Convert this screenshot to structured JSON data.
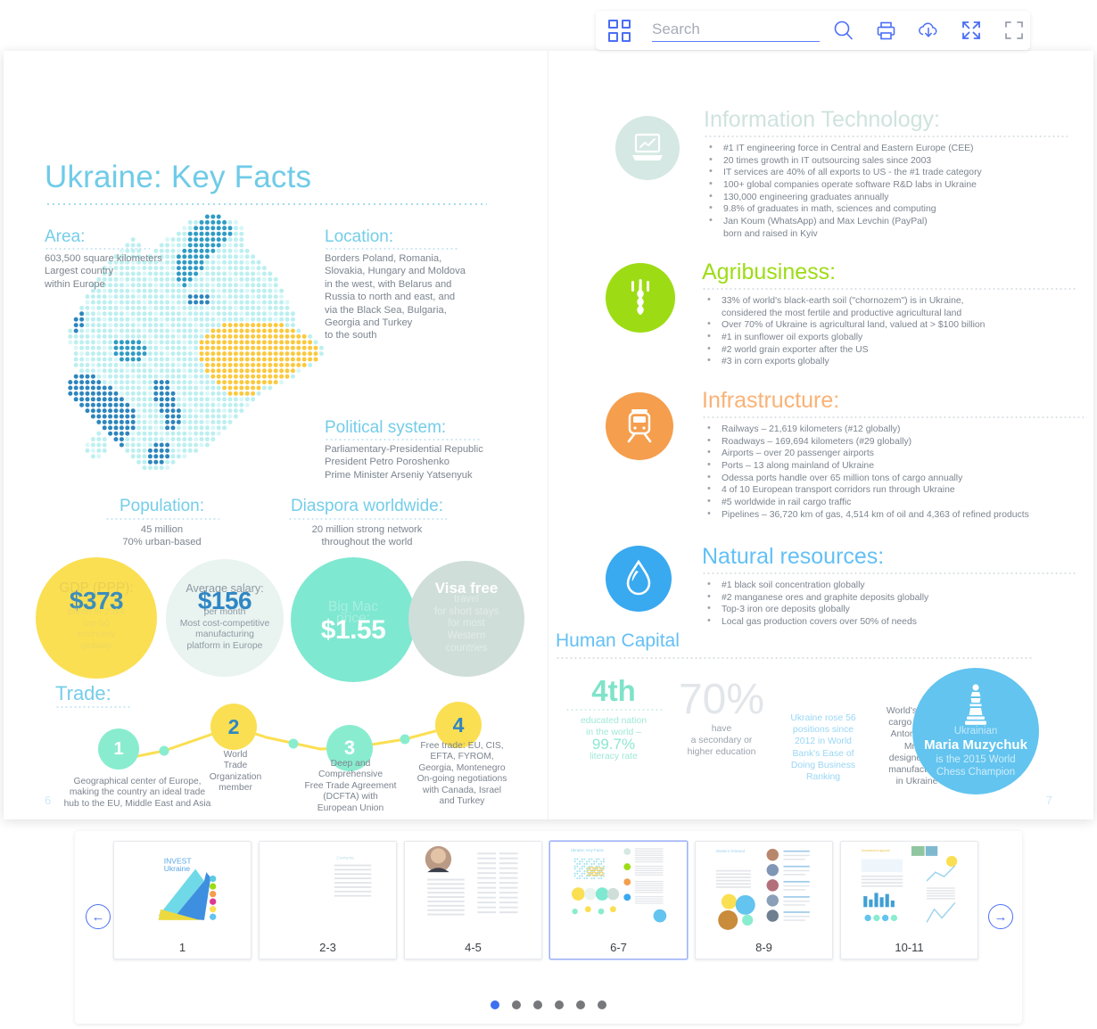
{
  "toolbar": {
    "grid_icon": "grid-icon",
    "search_placeholder": "Search",
    "search_value": "",
    "search_icon": "search-icon",
    "print_icon": "print-icon",
    "download_icon": "cloud-download-icon",
    "expand_icon": "expand-icon",
    "fullscreen_icon": "fullscreen-icon"
  },
  "left_page": {
    "page_number": "6",
    "title": "Ukraine: Key Facts",
    "area": {
      "head": "Area:",
      "body": "603,500 square kilometers\nLargest country\nwithin Europe"
    },
    "location": {
      "head": "Location:",
      "body": "Borders Poland, Romania,\nSlovakia, Hungary and Moldova\nin the west, with Belarus and\nRussia to north and east, and\nvia the Black Sea, Bulgaria,\nGeorgia and Turkey\nto the south"
    },
    "political": {
      "head": "Political system:",
      "body": "Parliamentary-Presidential Republic\nPresident Petro Poroshenko\nPrime Minister Arseniy Yatsenyuk"
    },
    "population": {
      "head": "Population:",
      "body": "45 million\n70% urban-based"
    },
    "diaspora": {
      "head": "Diaspora worldwide:",
      "body": "20 million strong network\nthroughout the world"
    },
    "stat_circles": [
      {
        "top": "GDP (PPP):",
        "big": "$373",
        "sub": "billion in 2014\ntop-50\neconomy\nglobally",
        "color": "#fbdf52"
      },
      {
        "top": "Average salary:",
        "big": "$156",
        "sub": "per month\nMost cost-competitive\nmanufacturing\nplatform in Europe",
        "color": "#e9f3f0"
      },
      {
        "top": "Big Mac\nprice:",
        "big": "$1.55",
        "sub": "",
        "color": "#7fe8d1"
      },
      {
        "top": "Visa free",
        "big": "",
        "sub": "travel\nfor short stays\nfor most\nWestern\ncountries",
        "color": "#cfded9"
      }
    ],
    "trade": {
      "head": "Trade:",
      "nodes": [
        {
          "num": "1",
          "caption": "Geographical center of Europe,\nmaking the country an ideal trade\nhub to the EU, Middle East and Asia"
        },
        {
          "num": "2",
          "caption": "World\nTrade\nOrganization\nmember"
        },
        {
          "num": "3",
          "caption": "Deep and\nComprehensive\nFree Trade Agreement\n(DCFTA) with\nEuropean Union"
        },
        {
          "num": "4",
          "caption": "Free trade: EU, CIS,\nEFTA, FYROM,\nGeorgia, Montenegro\nOn-going negotiations\nwith Canada, Israel\nand Turkey"
        }
      ]
    }
  },
  "right_page": {
    "page_number": "7",
    "sections": [
      {
        "title": "Information Technology:",
        "icon": "laptop-chart-icon",
        "color": "#d6e8e3",
        "items": [
          "#1 IT engineering force in Central and Eastern Europe (CEE)",
          "20 times growth in IT outsourcing sales since 2003",
          "IT services are 40% of all exports to US - the #1 trade category",
          "100+ global companies operate software R&D labs in Ukraine",
          "130,000 engineering graduates annually",
          "9.8% of graduates in math, sciences and computing",
          "Jan Koum (WhatsApp) and Max Levchin (PayPal)",
          "born and raised in Kyiv"
        ]
      },
      {
        "title": "Agribusiness:",
        "icon": "wheat-icon",
        "color": "#9ddc14",
        "items": [
          "33% of world's black-earth soil (\"chornozem\") is in Ukraine,",
          "considered the most fertile and productive agricultural land",
          "Over 70% of Ukraine is agricultural land, valued at > $100 billion",
          "#1 in sunflower oil exports globally",
          "#2 world grain exporter after the US",
          "#3 in corn exports globally"
        ]
      },
      {
        "title": "Infrastructure:",
        "icon": "train-icon",
        "color": "#f59e4d",
        "items": [
          "Railways – 21,619 kilometers (#12 globally)",
          "Roadways – 169,694 kilometers (#29 globally)",
          "Airports – over 20 passenger airports",
          "Ports – 13 along mainland of Ukraine",
          "Odessa ports handle over 65 million tons of cargo annually",
          "4 of 10 European transport corridors run through Ukraine",
          "#5 worldwide in rail cargo traffic",
          "Pipelines – 36,720 km of gas, 4,514 km of oil and 4,363 of refined products"
        ]
      },
      {
        "title": "Natural resources:",
        "icon": "water-drop-icon",
        "color": "#39a9f0",
        "items": [
          "#1 black soil concentration globally",
          "#2 manganese ores and graphite deposits globally",
          "Top-3 iron ore deposits globally",
          "Local gas production covers over 50% of needs"
        ]
      }
    ],
    "human_capital": {
      "title": "Human Capital",
      "col1_big": "4th",
      "col1_line1": "educated nation\nin the world –",
      "col1_pct": "99.7%",
      "col1_line2": "literacy rate",
      "col2_big": "70%",
      "col2_text": "have\na secondary or\nhigher education",
      "col3_text": "Ukraine rose 56\npositions since\n2012 in World\nBank's Ease of\nDoing Business\nRanking",
      "col4_text": "World's largest\ncargo aircraft,\nAntonov-225\nMriya,\ndesigned and\nmanufactured\nin Ukraine",
      "circle_line1": "Ukrainian",
      "circle_line2": "Maria Muzychuk",
      "circle_line3": "is the 2015 World\nChess Champion",
      "circle_icon": "chess-queen-icon",
      "circle_color": "#62c4ef"
    }
  },
  "strip": {
    "prev_label": "←",
    "next_label": "→",
    "thumbs": [
      {
        "label": "1",
        "selected": false
      },
      {
        "label": "2-3",
        "selected": false
      },
      {
        "label": "4-5",
        "selected": false
      },
      {
        "label": "6-7",
        "selected": true
      },
      {
        "label": "8-9",
        "selected": false
      },
      {
        "label": "10-11",
        "selected": false
      }
    ],
    "pagination_dots": 6,
    "pagination_active": 0
  }
}
